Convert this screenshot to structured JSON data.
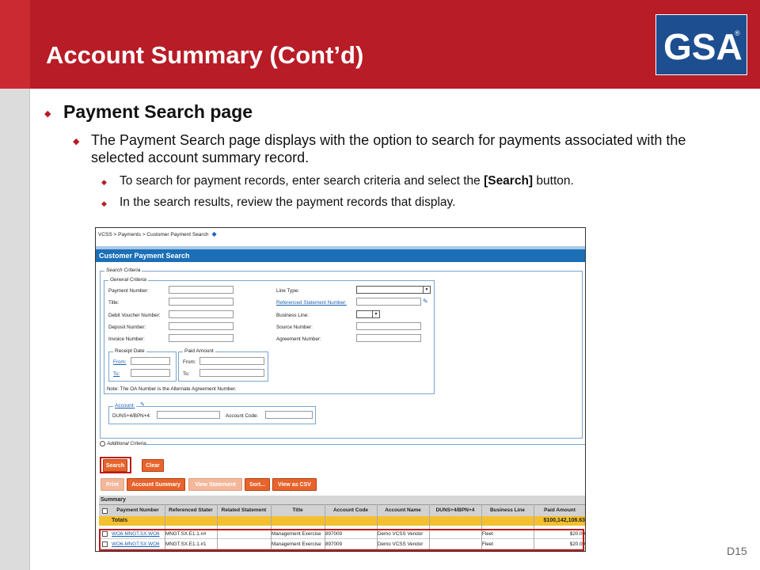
{
  "slide": {
    "title": "Account Summary (Cont’d)",
    "logo_text": "GSA",
    "logo_reg": "®",
    "bullet1": "Payment Search page",
    "bullet2": "The Payment Search page displays with the option to search for payments associated with the selected account summary record.",
    "bullet3_pre": "To search for payment records, enter search criteria and select the ",
    "bullet3_bold": "[Search]",
    "bullet3_post": " button.",
    "bullet4": "In the search results, review the payment records that display.",
    "slide_number": "D15"
  },
  "screen": {
    "breadcrumb": "VCSS > Payments > Customer Payment Search",
    "panel_title": "Customer Payment Search",
    "search_criteria": "Search Criteria",
    "general_criteria": "General Criteria",
    "labels": {
      "payment_number": "Payment Number:",
      "title": "Title:",
      "debit_voucher": "Debit Voucher Number:",
      "deposit_number": "Deposit Number:",
      "invoice_number": "Invoice Number:",
      "line_type": "Line Type:",
      "ref_statement": "Referenced Statement Number:",
      "business_line": "Business Line:",
      "source_number": "Source Number:",
      "agreement_number": "Agreement Number:"
    },
    "receipt_date": "Receipt Date",
    "paid_amount": "Paid Amount",
    "from_link": "From:",
    "to_link": "To:",
    "from_label": "From:",
    "to_label": "To:",
    "note": "Note: The OA Number is the Alternate Agreement Number.",
    "account_legend": "Account:",
    "duns_label": "DUNS+4/BPN+4:",
    "account_code_label": "Account Code:",
    "additional_criteria": "Additional Criteria",
    "search_btn": "Search",
    "clear_btn": "Clear",
    "action_buttons": [
      "Print",
      "Account Summary",
      "View Statement",
      "Sort...",
      "View as CSV"
    ],
    "summary": "Summary",
    "columns": [
      "Payment Number",
      "Referenced Stater",
      "Related Statement",
      "Title",
      "Account Code",
      "Account Name",
      "DUNS+4/BPN+4",
      "Business Line",
      "Paid Amount"
    ],
    "totals_label": "Totals",
    "totals_amount": "$100,142,108.63",
    "rows": [
      {
        "payment": "WO6-MNGT.SX.WO6",
        "ref": "MNGT.SX.E1.1.##",
        "related": "",
        "title": "Management Exercise",
        "code": "897009",
        "name": "Demo VCSS Vendor",
        "duns": "",
        "line": "Fleet",
        "amount": "$20.00"
      },
      {
        "payment": "WO6-MNGT.SX.WO6",
        "ref": "MNGT.SX.E1.1.#1",
        "related": "",
        "title": "Management Exercise",
        "code": "897009",
        "name": "Demo VCSS Vendor",
        "duns": "",
        "line": "Fleet",
        "amount": "$20.00"
      }
    ]
  }
}
